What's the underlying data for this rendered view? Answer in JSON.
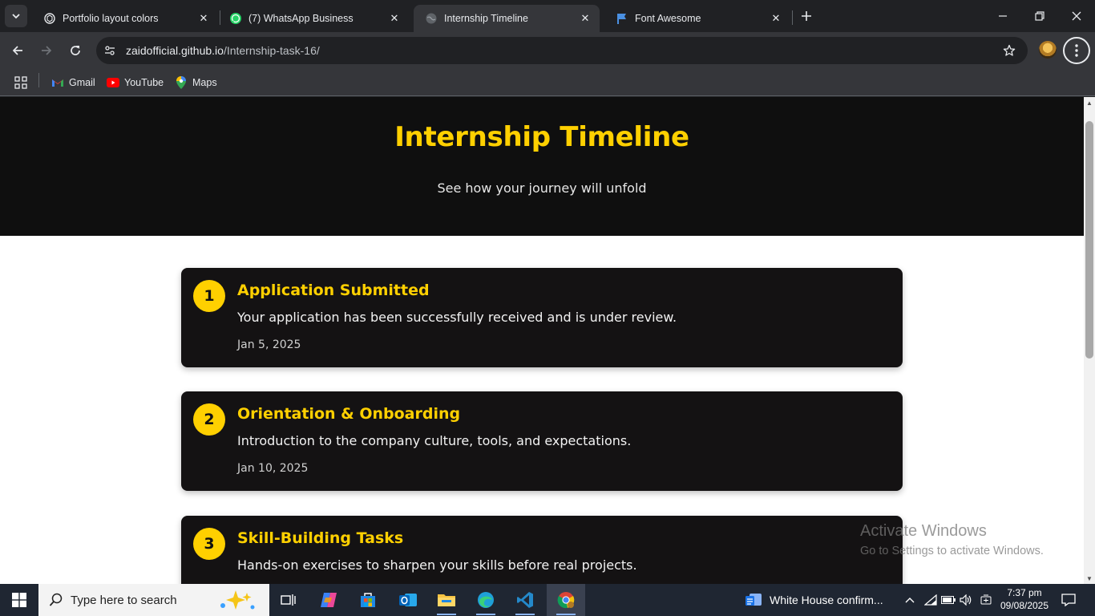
{
  "browser": {
    "tabs": [
      {
        "title": "Portfolio layout colors",
        "icon": "openai-icon",
        "active": false
      },
      {
        "title": "(7) WhatsApp Business",
        "icon": "whatsapp-icon",
        "active": false
      },
      {
        "title": "Internship Timeline",
        "icon": "globe-icon",
        "active": true
      },
      {
        "title": "Font Awesome",
        "icon": "flag-icon",
        "active": false
      }
    ],
    "url_host": "zaidofficial.github.io",
    "url_path": "/Internship-task-16/",
    "bookmarks": [
      {
        "label": "Gmail",
        "icon": "gmail-icon"
      },
      {
        "label": "YouTube",
        "icon": "youtube-icon"
      },
      {
        "label": "Maps",
        "icon": "maps-icon"
      }
    ]
  },
  "page": {
    "title": "Internship Timeline",
    "subtitle": "See how your journey will unfold",
    "accent": "#ffd000",
    "steps": [
      {
        "number": "1",
        "title": "Application Submitted",
        "description": "Your application has been successfully received and is under review.",
        "date": "Jan 5, 2025"
      },
      {
        "number": "2",
        "title": "Orientation & Onboarding",
        "description": "Introduction to the company culture, tools, and expectations.",
        "date": "Jan 10, 2025"
      },
      {
        "number": "3",
        "title": "Skill-Building Tasks",
        "description": "Hands-on exercises to sharpen your skills before real projects.",
        "date": ""
      }
    ]
  },
  "watermark": {
    "line1": "Activate Windows",
    "line2": "Go to Settings to activate Windows."
  },
  "taskbar": {
    "search_placeholder": "Type here to search",
    "news_text": "White House confirm...",
    "time": "7:37 pm",
    "date": "09/08/2025"
  }
}
